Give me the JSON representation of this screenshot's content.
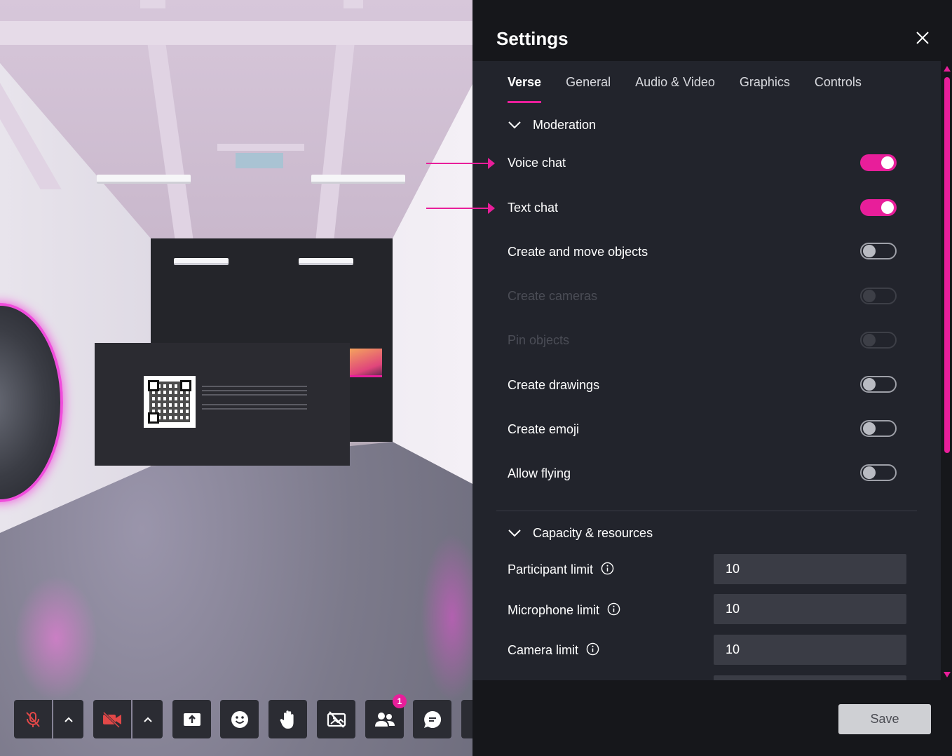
{
  "settings": {
    "title": "Settings",
    "tabs": [
      {
        "label": "Verse",
        "active": true
      },
      {
        "label": "General",
        "active": false
      },
      {
        "label": "Audio & Video",
        "active": false
      },
      {
        "label": "Graphics",
        "active": false
      },
      {
        "label": "Controls",
        "active": false
      }
    ],
    "moderation": {
      "heading": "Moderation",
      "items": [
        {
          "label": "Voice chat",
          "on": true,
          "disabled": false
        },
        {
          "label": "Text chat",
          "on": true,
          "disabled": false
        },
        {
          "label": "Create and move objects",
          "on": false,
          "disabled": false
        },
        {
          "label": "Create cameras",
          "on": false,
          "disabled": true
        },
        {
          "label": "Pin objects",
          "on": false,
          "disabled": true
        },
        {
          "label": "Create drawings",
          "on": false,
          "disabled": false
        },
        {
          "label": "Create emoji",
          "on": false,
          "disabled": false
        },
        {
          "label": "Allow flying",
          "on": false,
          "disabled": false
        }
      ]
    },
    "capacity": {
      "heading": "Capacity & resources",
      "items": [
        {
          "label": "Participant limit",
          "value": "10"
        },
        {
          "label": "Microphone limit",
          "value": "10"
        },
        {
          "label": "Camera limit",
          "value": "10"
        }
      ]
    },
    "save_label": "Save"
  },
  "toolbar": {
    "buttons": [
      "mic-muted-icon",
      "chevron-up-icon",
      "camera-off-icon",
      "chevron-up-icon",
      "share-screen-icon",
      "emoji-icon",
      "raise-hand-icon",
      "hide-overlay-icon",
      "participants-icon",
      "chat-icon"
    ],
    "participants_badge": "1"
  },
  "colors": {
    "accent": "#e81e9a",
    "panel_bg": "#22242c",
    "header_bg": "#16171b",
    "input_bg": "#3a3c45"
  }
}
